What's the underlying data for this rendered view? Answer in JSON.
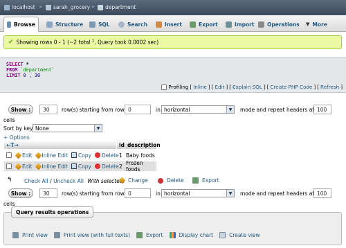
{
  "breadcrumb": {
    "server": "localhost",
    "database": "sarah_grocery",
    "table": "department"
  },
  "tabs": [
    {
      "label": "Browse",
      "icon": "browse-icon",
      "active": true
    },
    {
      "label": "Structure",
      "icon": "structure-icon"
    },
    {
      "label": "SQL",
      "icon": "sql-icon"
    },
    {
      "label": "Search",
      "icon": "search-icon"
    },
    {
      "label": "Insert",
      "icon": "insert-icon"
    },
    {
      "label": "Export",
      "icon": "export-icon"
    },
    {
      "label": "Import",
      "icon": "import-icon"
    },
    {
      "label": "Operations",
      "icon": "wrench-icon"
    },
    {
      "label": "More",
      "icon": "chevron-down-icon"
    }
  ],
  "message": {
    "pre": "Showing rows 0 - 1 (~2 total ",
    "sup": "1",
    "post": ", Query took 0.0002 sec)"
  },
  "sql": {
    "select_kw": "SELECT",
    "select_rest": " *",
    "from_kw": "FROM",
    "from_table": " `department`",
    "limit_kw": "LIMIT",
    "limit_vals": " 0 , 30"
  },
  "sql_links": {
    "profiling": "Profiling",
    "inline": "Inline",
    "edit": "Edit",
    "explain": "Explain SQL",
    "create_php": "Create PHP Code",
    "refresh": "Refresh"
  },
  "nav": {
    "show_label": "Show :",
    "rows_value": "30",
    "rows_text": "row(s) starting from row #",
    "start_value": "0",
    "in_text": "in",
    "mode_value": "horizontal",
    "mode_text": "mode and repeat headers after",
    "repeat_value": "100",
    "cells_text": "cells"
  },
  "sort": {
    "label": "Sort by key:",
    "value": "None"
  },
  "options_link": "+ Options",
  "table": {
    "arrows": "←T→",
    "headers": [
      "id",
      "description"
    ],
    "rows": [
      {
        "id": "1",
        "description": "Baby foods"
      },
      {
        "id": "2",
        "description": "Frozen foods"
      }
    ],
    "edit": "Edit",
    "inline_edit": "Inline Edit",
    "copy": "Copy",
    "delete": "Delete"
  },
  "bulk": {
    "check_all": "Check All",
    "separator": " / ",
    "uncheck_all": "Uncheck All",
    "with_selected": "With selected:",
    "change": "Change",
    "delete": "Delete",
    "export": "Export"
  },
  "query_ops": {
    "legend": "Query results operations",
    "items": [
      "Print view",
      "Print view (with full texts)",
      "Export",
      "Display chart",
      "Create view"
    ]
  }
}
